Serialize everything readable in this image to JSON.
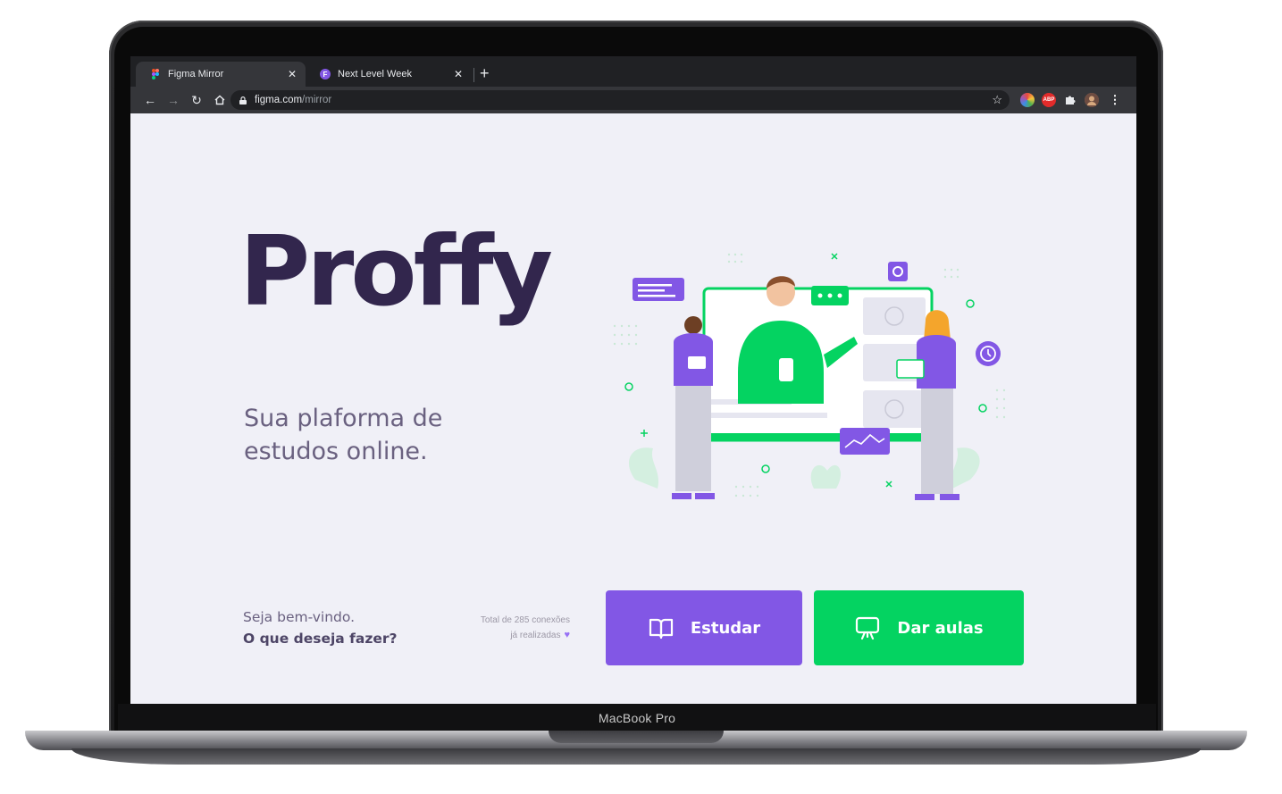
{
  "device": {
    "label": "MacBook Pro"
  },
  "browser": {
    "tabs": [
      {
        "label": "Figma Mirror",
        "active": true,
        "favicon": "figma-icon"
      },
      {
        "label": "Next Level Week",
        "active": false,
        "favicon": "purple-f-icon"
      }
    ],
    "url_host": "figma.com",
    "url_path": "/mirror",
    "extensions": [
      "color-wheel-icon",
      "adblock-icon",
      "puzzle-icon",
      "profile-avatar",
      "menu-icon"
    ],
    "adblock_label": "ABP"
  },
  "hero": {
    "title": "Proffy",
    "subtitle": "Sua plaforma de estudos online."
  },
  "welcome": {
    "line1": "Seja bem-vindo.",
    "line2": "O que deseja fazer?"
  },
  "connections": {
    "line1": "Total de 285 conexões",
    "line2": "já realizadas"
  },
  "buttons": {
    "study": {
      "label": "Estudar",
      "icon": "book-icon",
      "color": "#8257e5"
    },
    "teach": {
      "label": "Dar aulas",
      "icon": "presentation-icon",
      "color": "#04d361"
    }
  },
  "colors": {
    "background": "#f0f0f7",
    "title": "#32264d",
    "text": "#6a6180",
    "purple": "#8257e5",
    "green": "#04d361"
  }
}
